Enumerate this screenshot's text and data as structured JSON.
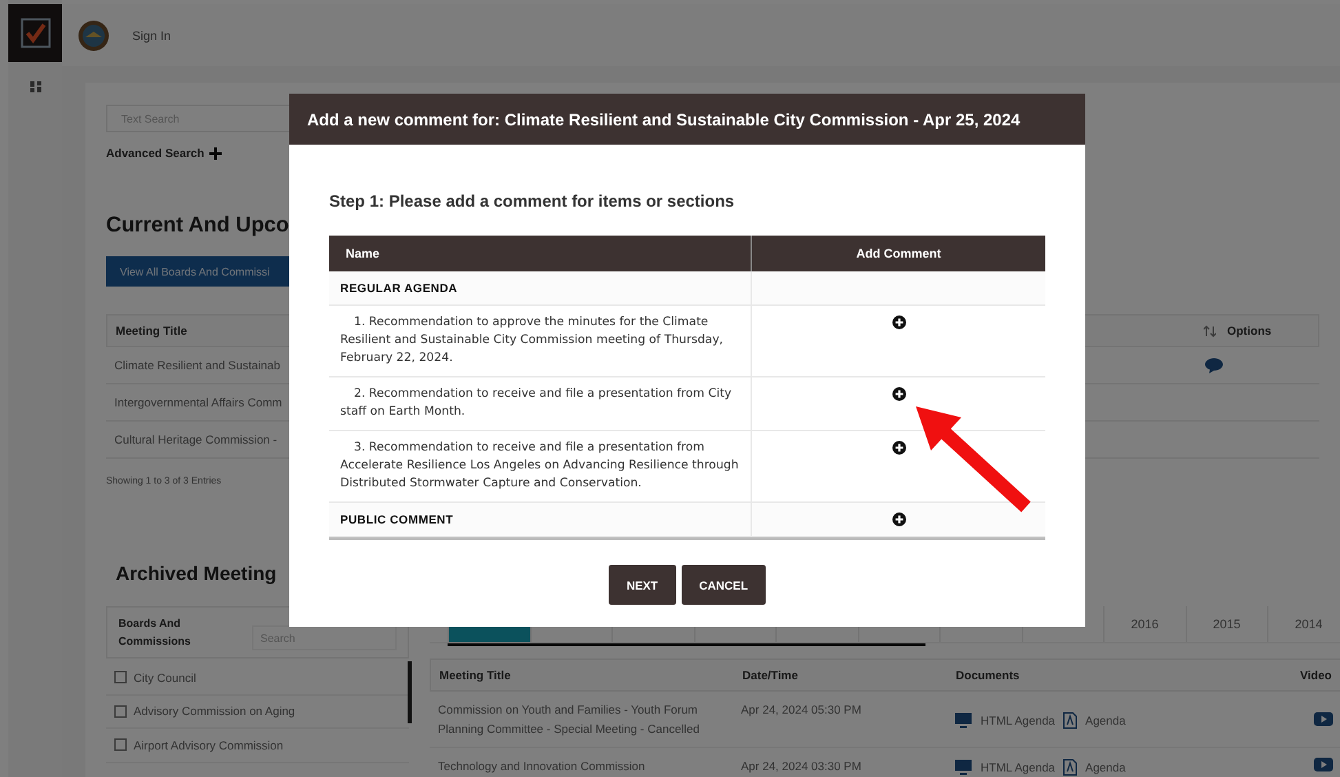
{
  "top_bar": {
    "sign_in": "Sign In"
  },
  "search": {
    "placeholder": "Text Search",
    "advanced_search": "Advanced Search"
  },
  "current_meetings": {
    "heading": "Current And Upco",
    "button": "View All Boards And Commissi",
    "columns": [
      "Meeting Title",
      "Options"
    ],
    "rows": [
      {
        "title": "Climate Resilient and Sustainab",
        "comment": true
      },
      {
        "title": "Intergovernmental Affairs Comm",
        "comment": false
      },
      {
        "title": "Cultural Heritage Commission -",
        "comment": false
      }
    ],
    "footer": "Showing 1 to 3 of 3 Entries"
  },
  "archived_meetings": {
    "heading": "Archived Meeting",
    "filter": {
      "label": "Boards And Commissions",
      "search_placeholder": "Search",
      "boards": [
        {
          "label": "City Council",
          "checked": false
        },
        {
          "label": "Advisory Commission on Aging",
          "checked": false
        },
        {
          "label": "Airport Advisory Commission",
          "checked": false
        }
      ]
    },
    "year_tabs": [
      {
        "selected": true
      },
      {
        "selected": false
      },
      {
        "selected": false
      },
      {
        "selected": false
      },
      {
        "selected": false
      },
      {
        "selected": false
      },
      {
        "selected": false
      },
      {
        "selected": false
      },
      {
        "label": "2016",
        "selected": false
      },
      {
        "label": "2015",
        "selected": false
      },
      {
        "label": "2014",
        "selected": false
      }
    ],
    "columns": [
      "Meeting Title",
      "Date/Time",
      "Documents",
      "Video"
    ],
    "rows": [
      {
        "title": "Commission on Youth and Families - Youth Forum Planning Committee - Special Meeting - Cancelled",
        "datetime": "Apr 24, 2024 05:30 PM",
        "html_agenda": "HTML Agenda",
        "agenda": "Agenda"
      },
      {
        "title": "Technology and Innovation Commission",
        "datetime": "Apr 24, 2024 03:30 PM",
        "html_agenda": "HTML Agenda",
        "agenda": "Agenda"
      }
    ]
  },
  "modal": {
    "title": "Add a new comment for: Climate Resilient and Sustainable City Commission - Apr 25, 2024",
    "step": "Step 1: Please add a comment for items or sections",
    "columns": [
      "Name",
      "Add Comment"
    ],
    "rows": [
      {
        "kind": "section",
        "name": "REGULAR AGENDA",
        "add_comment": false
      },
      {
        "kind": "item",
        "name": "1. Recommendation to approve the minutes for the Climate Resilient and Sustainable City Commission meeting of Thursday, February 22, 2024.",
        "add_comment": true
      },
      {
        "kind": "item",
        "name": "2. Recommendation to receive and file a presentation from City staff on Earth Month.",
        "add_comment": true
      },
      {
        "kind": "item",
        "name": "3. Recommendation to receive and file a presentation from Accelerate Resilience Los Angeles on Advancing Resilience through Distributed Stormwater Capture and Conservation.",
        "add_comment": true
      },
      {
        "kind": "section",
        "name": "PUBLIC COMMENT",
        "add_comment": true
      }
    ],
    "buttons": [
      "NEXT",
      "CANCEL"
    ]
  }
}
